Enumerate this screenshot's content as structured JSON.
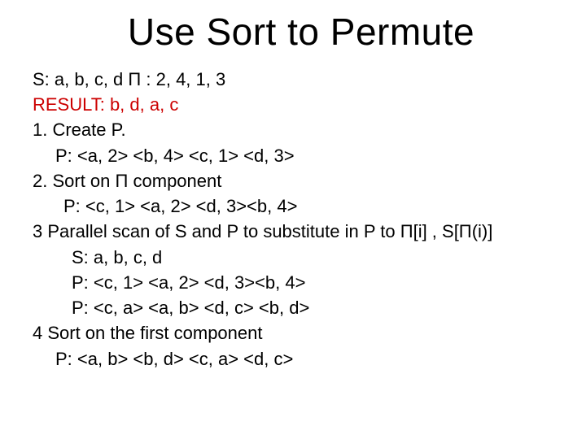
{
  "title": "Use Sort to Permute",
  "lines": {
    "l1": "S:   a, b, c, d   Π :   2, 4, 1, 3",
    "l2": "RESULT:   b, d, a, c",
    "l3": "1.   Create P.",
    "l4": "P:  <a, 2> <b, 4> <c, 1> <d, 3>",
    "l5": "2. Sort on Π component",
    "l6": "P:  <c, 1> <a, 2> <d, 3><b, 4>",
    "l7": "3 Parallel scan of S and P to substitute in P to Π[i] , S[Π(i)]",
    "l8": "S:   a, b, c, d",
    "l9": "P:  <c, 1> <a, 2> <d, 3><b, 4>",
    "l10": "P: <c, a> <a, b> <d, c> <b, d>",
    "l11": "4 Sort on the first component",
    "l12": "P: <a, b> <b, d> <c, a> <d, c>"
  }
}
